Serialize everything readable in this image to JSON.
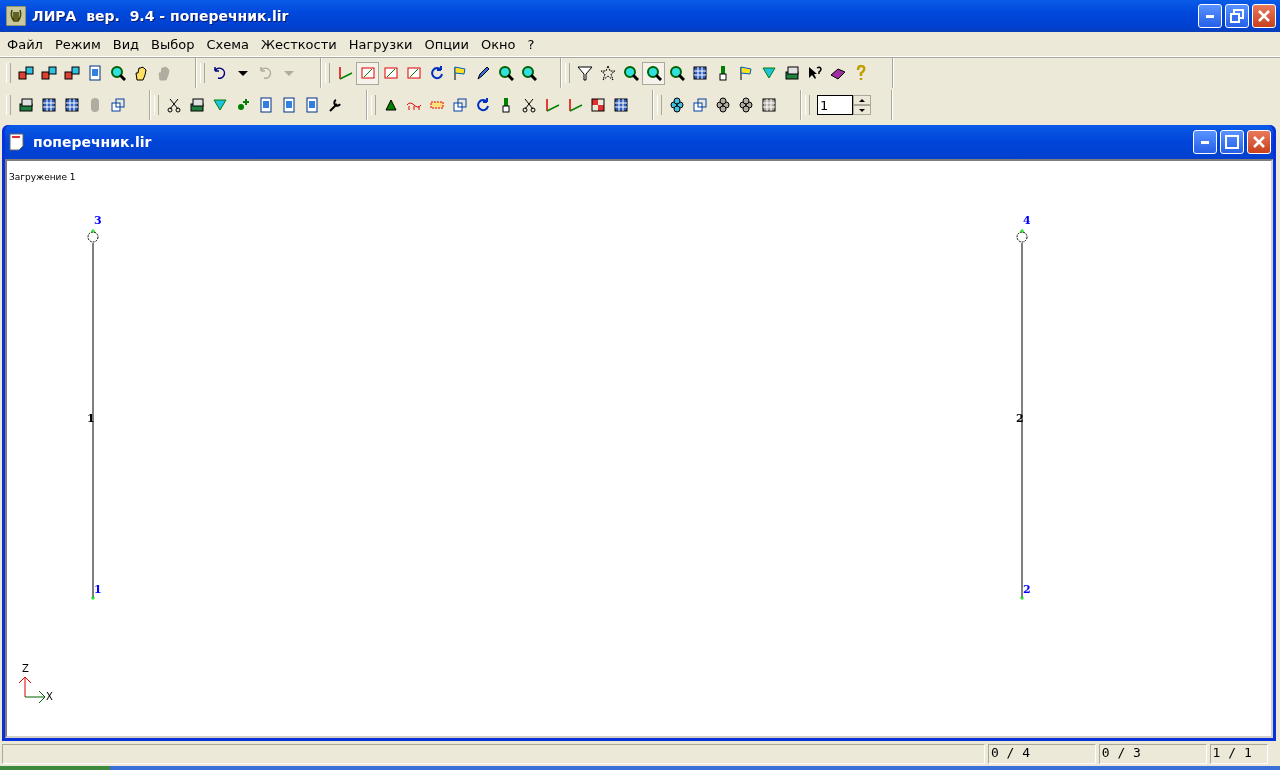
{
  "window": {
    "title": "ЛИРА  вер.  9.4 - поперечник.lir"
  },
  "menu": [
    {
      "label": "Файл"
    },
    {
      "label": "Режим"
    },
    {
      "label": "Вид"
    },
    {
      "label": "Выбор"
    },
    {
      "label": "Схема"
    },
    {
      "label": "Жесткости"
    },
    {
      "label": "Нагрузки"
    },
    {
      "label": "Опции"
    },
    {
      "label": "Окно"
    },
    {
      "label": "?"
    }
  ],
  "toolbar_rows": [
    [
      {
        "buttons": [
          {
            "disabled": false,
            "pressed": false
          },
          {
            "disabled": false,
            "pressed": false
          },
          {
            "disabled": false,
            "pressed": false
          },
          {
            "disabled": false,
            "pressed": false
          },
          {
            "disabled": false,
            "pressed": false
          },
          {
            "disabled": false,
            "pressed": false
          },
          {
            "disabled": true,
            "pressed": false
          }
        ]
      },
      {
        "buttons": [
          {
            "disabled": false,
            "pressed": false
          },
          {
            "disabled": false,
            "pressed": false
          },
          {
            "disabled": true,
            "pressed": false
          },
          {
            "disabled": true,
            "pressed": false
          }
        ]
      },
      {
        "buttons": [
          {
            "disabled": false,
            "pressed": false
          },
          {
            "disabled": false,
            "pressed": true
          },
          {
            "disabled": false,
            "pressed": false
          },
          {
            "disabled": false,
            "pressed": false
          },
          {
            "disabled": false,
            "pressed": false
          },
          {
            "disabled": false,
            "pressed": false
          },
          {
            "disabled": false,
            "pressed": false
          },
          {
            "disabled": false,
            "pressed": false
          },
          {
            "disabled": false,
            "pressed": false
          }
        ]
      },
      {
        "buttons": [
          {
            "disabled": false,
            "pressed": false
          },
          {
            "disabled": false,
            "pressed": false
          },
          {
            "disabled": false,
            "pressed": false
          },
          {
            "disabled": false,
            "pressed": true
          },
          {
            "disabled": false,
            "pressed": false
          },
          {
            "disabled": false,
            "pressed": false
          },
          {
            "disabled": false,
            "pressed": false
          },
          {
            "disabled": false,
            "pressed": false
          },
          {
            "disabled": false,
            "pressed": false
          },
          {
            "disabled": false,
            "pressed": false
          },
          {
            "disabled": false,
            "pressed": false
          },
          {
            "disabled": false,
            "pressed": false
          },
          {
            "disabled": false,
            "pressed": false
          }
        ]
      }
    ],
    [
      {
        "buttons": [
          {
            "disabled": false,
            "pressed": false
          },
          {
            "disabled": false,
            "pressed": false
          },
          {
            "disabled": false,
            "pressed": false
          },
          {
            "disabled": true,
            "pressed": false
          },
          {
            "disabled": false,
            "pressed": false
          }
        ]
      },
      {
        "buttons": [
          {
            "disabled": false,
            "pressed": false
          },
          {
            "disabled": false,
            "pressed": false
          },
          {
            "disabled": false,
            "pressed": false
          },
          {
            "disabled": false,
            "pressed": false
          },
          {
            "disabled": false,
            "pressed": false
          },
          {
            "disabled": false,
            "pressed": false
          },
          {
            "disabled": false,
            "pressed": false
          },
          {
            "disabled": false,
            "pressed": false
          }
        ]
      },
      {
        "buttons": [
          {
            "disabled": false,
            "pressed": false
          },
          {
            "disabled": false,
            "pressed": false
          },
          {
            "disabled": false,
            "pressed": false
          },
          {
            "disabled": false,
            "pressed": false
          },
          {
            "disabled": false,
            "pressed": false
          },
          {
            "disabled": false,
            "pressed": false
          },
          {
            "disabled": false,
            "pressed": false
          },
          {
            "disabled": false,
            "pressed": false
          },
          {
            "disabled": false,
            "pressed": false
          },
          {
            "disabled": false,
            "pressed": false
          },
          {
            "disabled": false,
            "pressed": false
          }
        ]
      },
      {
        "buttons": [
          {
            "disabled": false,
            "pressed": false
          },
          {
            "disabled": false,
            "pressed": false
          },
          {
            "disabled": true,
            "pressed": false
          },
          {
            "disabled": true,
            "pressed": false
          },
          {
            "disabled": true,
            "pressed": false
          }
        ]
      }
    ]
  ],
  "load_case_spinner": {
    "value": "1"
  },
  "document": {
    "title": "поперечник.lir",
    "load_case_label": "Загружение  1",
    "nodes": [
      {
        "label": "3",
        "hinge": true
      },
      {
        "label": "4",
        "hinge": true
      },
      {
        "label": "1",
        "hinge": false
      },
      {
        "label": "2",
        "hinge": false
      }
    ],
    "bars": [
      {
        "label": "1"
      },
      {
        "label": "2"
      }
    ],
    "axes": {
      "vertical": "Z",
      "horizontal": "X"
    }
  },
  "status_bar": [
    {
      "text": "0 / 4"
    },
    {
      "text": "0 / 3"
    },
    {
      "text": "1 / 1"
    }
  ]
}
